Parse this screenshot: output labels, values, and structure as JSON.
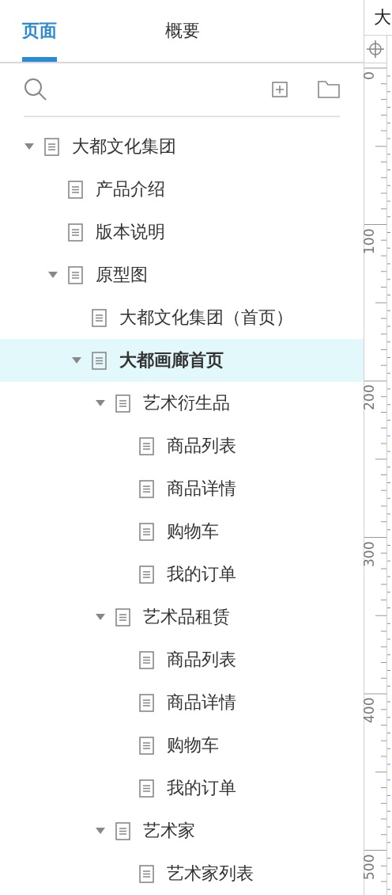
{
  "tabs": [
    {
      "label": "页面",
      "selected": true
    },
    {
      "label": "概要",
      "selected": false
    }
  ],
  "tree": [
    {
      "label": "大都文化集团",
      "expanded": true,
      "selected": false,
      "children": [
        {
          "label": "产品介绍",
          "selected": false
        },
        {
          "label": "版本说明",
          "selected": false
        },
        {
          "label": "原型图",
          "expanded": true,
          "selected": false,
          "children": [
            {
              "label": "大都文化集团（首页）",
              "selected": false
            },
            {
              "label": "大都画廊首页",
              "expanded": true,
              "selected": true,
              "children": [
                {
                  "label": "艺术衍生品",
                  "expanded": true,
                  "selected": false,
                  "children": [
                    {
                      "label": "商品列表",
                      "selected": false
                    },
                    {
                      "label": "商品详情",
                      "selected": false
                    },
                    {
                      "label": "购物车",
                      "selected": false
                    },
                    {
                      "label": "我的订单",
                      "selected": false
                    }
                  ]
                },
                {
                  "label": "艺术品租赁",
                  "expanded": true,
                  "selected": false,
                  "children": [
                    {
                      "label": "商品列表",
                      "selected": false
                    },
                    {
                      "label": "商品详情",
                      "selected": false
                    },
                    {
                      "label": "购物车",
                      "selected": false
                    },
                    {
                      "label": "我的订单",
                      "selected": false
                    }
                  ]
                },
                {
                  "label": "艺术家",
                  "expanded": true,
                  "selected": false,
                  "children": [
                    {
                      "label": "艺术家列表",
                      "selected": false
                    }
                  ]
                }
              ]
            }
          ]
        }
      ]
    }
  ],
  "canvas_tab": {
    "label": "大"
  },
  "ruler_labels": [
    "0",
    "100",
    "200",
    "300",
    "400",
    "500"
  ]
}
